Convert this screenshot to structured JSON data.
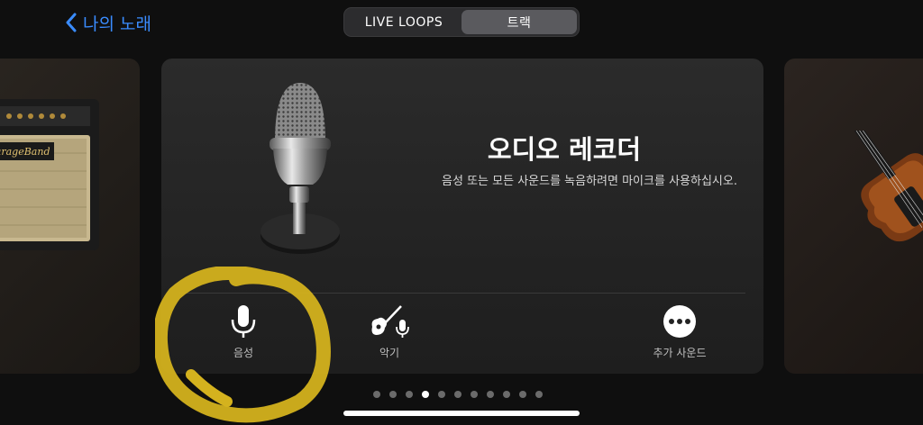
{
  "nav": {
    "back_label": "나의 노래"
  },
  "segments": [
    {
      "label": "LIVE LOOPS",
      "active": false
    },
    {
      "label": "트랙",
      "active": true
    }
  ],
  "amp": {
    "brand": "GarageBand"
  },
  "main_card": {
    "title": "오디오 레코더",
    "description": "음성 또는 모든 사운드를 녹음하려면 마이크를 사용하십시오.",
    "options": [
      {
        "label": "음성",
        "icon": "microphone-icon"
      },
      {
        "label": "악기",
        "icon": "guitar-microphone-icon"
      },
      {
        "label": "추가 사운드",
        "icon": "more-icon"
      }
    ]
  },
  "pagination": {
    "count": 11,
    "active_index": 3
  },
  "colors": {
    "accent": "#3a8cff",
    "highlight": "#e6c22a",
    "background": "#0f0f0f"
  }
}
